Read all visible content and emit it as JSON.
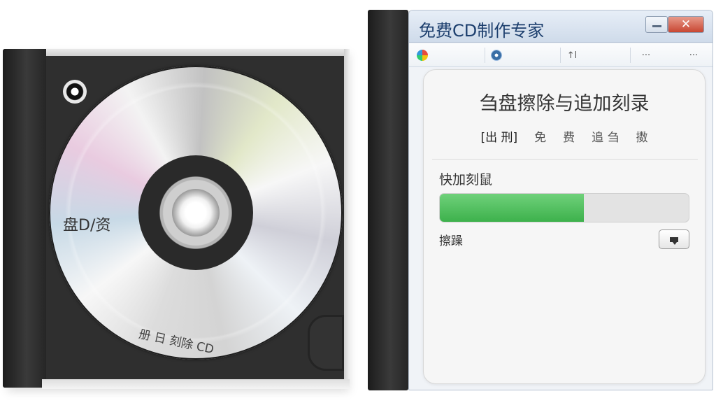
{
  "cd_case": {
    "disc_label_top": "盘D/资",
    "disc_label_bottom": "册 日  刻除 CD"
  },
  "window": {
    "title": "免费CD制作专家",
    "close_label": "✕"
  },
  "toolbar": {
    "items": [
      {
        "icon": "home-icon"
      },
      {
        "icon": "disc-icon"
      },
      {
        "icon": "sort-icon",
        "label": "↑l"
      },
      {
        "icon": "more-icon",
        "label": "···"
      },
      {
        "icon": "more-icon",
        "label": "···"
      }
    ]
  },
  "panel": {
    "title": "刍盘擦除与追加刻录",
    "tabs": [
      "[出 刑]",
      "免",
      "费",
      "追 刍",
      "擞"
    ],
    "section_label": "快加刻鼠",
    "progress_percent": 58,
    "status_label": "擦躁"
  },
  "colors": {
    "progress": "#3db14c",
    "titlebar": "#cfdbea",
    "close_button": "#c84632"
  }
}
